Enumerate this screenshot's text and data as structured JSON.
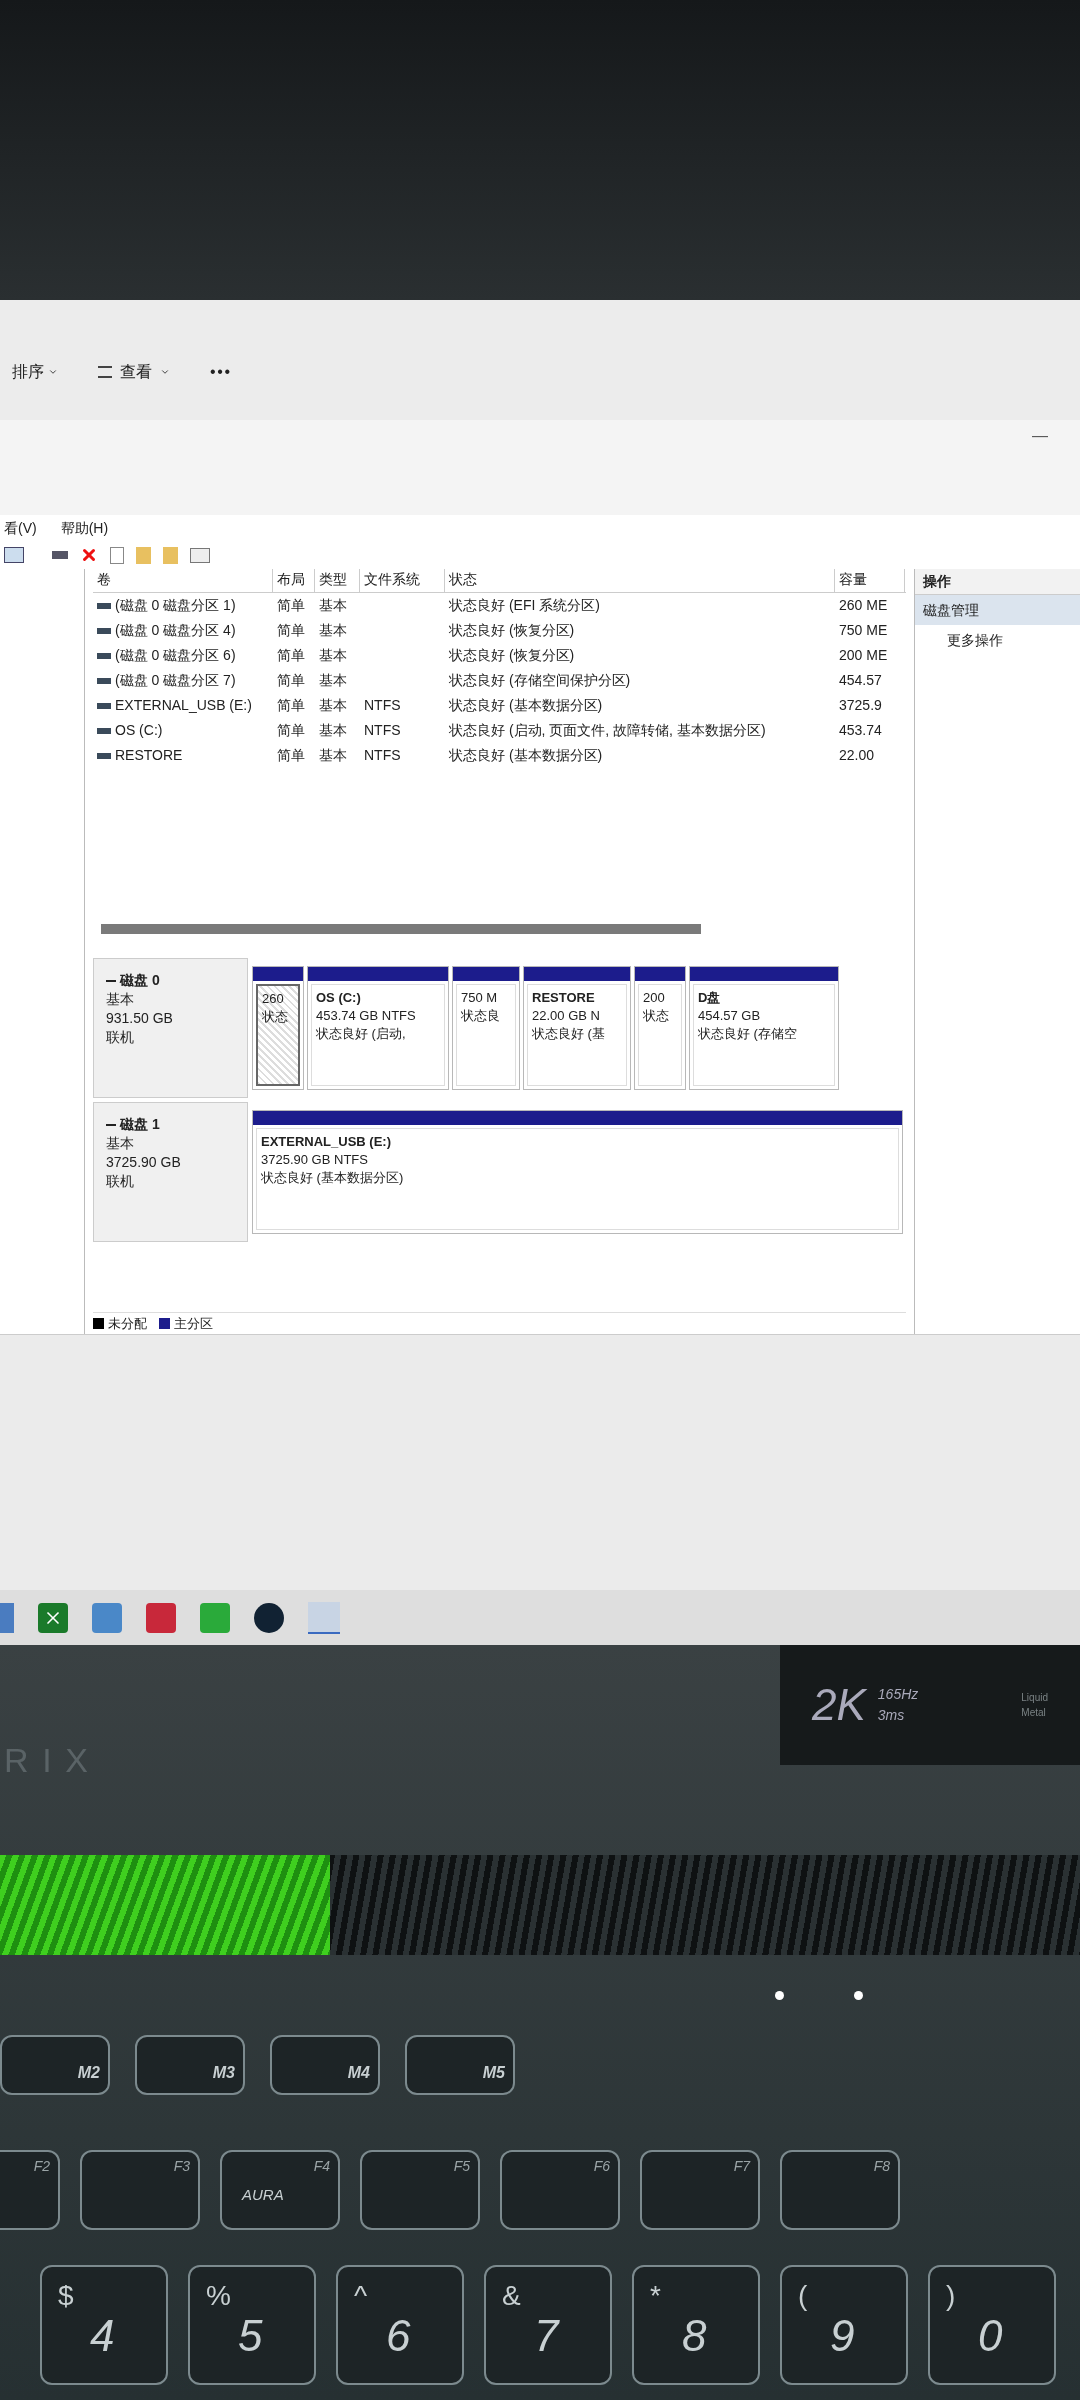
{
  "explorer_toolbar": {
    "sort": "排序",
    "view": "查看",
    "more": "•••",
    "minimize": "—"
  },
  "menu": [
    {
      "label": "看(V)"
    },
    {
      "label": "帮助(H)"
    }
  ],
  "volume_table": {
    "columns": [
      "卷",
      "布局",
      "类型",
      "文件系统",
      "状态",
      "容量"
    ],
    "rows": [
      {
        "volume": "(磁盘 0 磁盘分区 1)",
        "layout": "简单",
        "type": "基本",
        "status": "状态良好 (EFI 系统分区)",
        "capacity": "260 ME"
      },
      {
        "volume": "(磁盘 0 磁盘分区 4)",
        "layout": "简单",
        "type": "基本",
        "status": "状态良好 (恢复分区)",
        "capacity": "750 ME"
      },
      {
        "volume": "(磁盘 0 磁盘分区 6)",
        "layout": "简单",
        "type": "基本",
        "status": "状态良好 (恢复分区)",
        "capacity": "200 ME"
      },
      {
        "volume": "(磁盘 0 磁盘分区 7)",
        "layout": "简单",
        "type": "基本",
        "status": "状态良好 (存储空间保护分区)",
        "capacity": "454.57"
      },
      {
        "volume": "EXTERNAL_USB (E:)",
        "layout": "简单",
        "type": "基本",
        "fs": "NTFS",
        "status": "状态良好 (基本数据分区)",
        "capacity": "3725.9"
      },
      {
        "volume": "OS (C:)",
        "layout": "简单",
        "type": "基本",
        "fs": "NTFS",
        "status": "状态良好 (启动, 页面文件, 故障转储, 基本数据分区)",
        "capacity": "453.74"
      },
      {
        "volume": "RESTORE",
        "layout": "简单",
        "type": "基本",
        "fs": "NTFS",
        "status": "状态良好 (基本数据分区)",
        "capacity": "22.00"
      }
    ]
  },
  "actions": {
    "title": "操作",
    "items": [
      {
        "label": "磁盘管理",
        "selected": true
      },
      {
        "label": "更多操作",
        "selected": false
      }
    ]
  },
  "disks": [
    {
      "name": "磁盘 0",
      "type": "基本",
      "size": "931.50 GB",
      "status": "联机",
      "partitions": [
        {
          "lines": [
            "260",
            "状态"
          ],
          "selected": true
        },
        {
          "title": "OS  (C:)",
          "lines": [
            "453.74 GB NTFS",
            "状态良好 (启动,"
          ],
          "selected": false
        },
        {
          "lines": [
            "750 M",
            "状态良"
          ],
          "selected": false
        },
        {
          "title": "RESTORE",
          "lines": [
            "22.00 GB N",
            "状态良好 (基"
          ],
          "selected": false
        },
        {
          "lines": [
            "200",
            "状态"
          ],
          "selected": false
        },
        {
          "title": "D盘",
          "lines": [
            "454.57 GB",
            "状态良好 (存储空"
          ],
          "selected": false
        }
      ]
    },
    {
      "name": "磁盘 1",
      "type": "基本",
      "size": "3725.90 GB",
      "status": "联机",
      "partitions": [
        {
          "title": "EXTERNAL_USB  (E:)",
          "lines": [
            "3725.90 GB NTFS",
            "状态良好 (基本数据分区)"
          ],
          "selected": false
        }
      ]
    }
  ],
  "legend": [
    {
      "label": "未分配",
      "color": "#000000"
    },
    {
      "label": "主分区",
      "color": "#1c1c8c"
    }
  ],
  "laptop": {
    "brand": "RIX",
    "badge": {
      "resolution": "2K",
      "refresh": "165Hz",
      "response": "3ms",
      "feature": [
        "Liquid",
        "Metal"
      ]
    },
    "macro_keys": [
      "M2",
      "M3",
      "M4",
      "M5"
    ],
    "function_keys": [
      {
        "label": "F2"
      },
      {
        "label": "F3"
      },
      {
        "label": "F4",
        "text": "AURA"
      },
      {
        "label": "F5"
      },
      {
        "label": "F6"
      },
      {
        "label": "F7"
      },
      {
        "label": "F8"
      }
    ],
    "number_keys": [
      {
        "shift": "$",
        "main": "4"
      },
      {
        "shift": "%",
        "main": "5"
      },
      {
        "shift": "^",
        "main": "6"
      },
      {
        "shift": "&",
        "main": "7"
      },
      {
        "shift": "*",
        "main": "8"
      },
      {
        "shift": "(",
        "main": "9"
      },
      {
        "shift": ")",
        "main": "0"
      }
    ]
  }
}
